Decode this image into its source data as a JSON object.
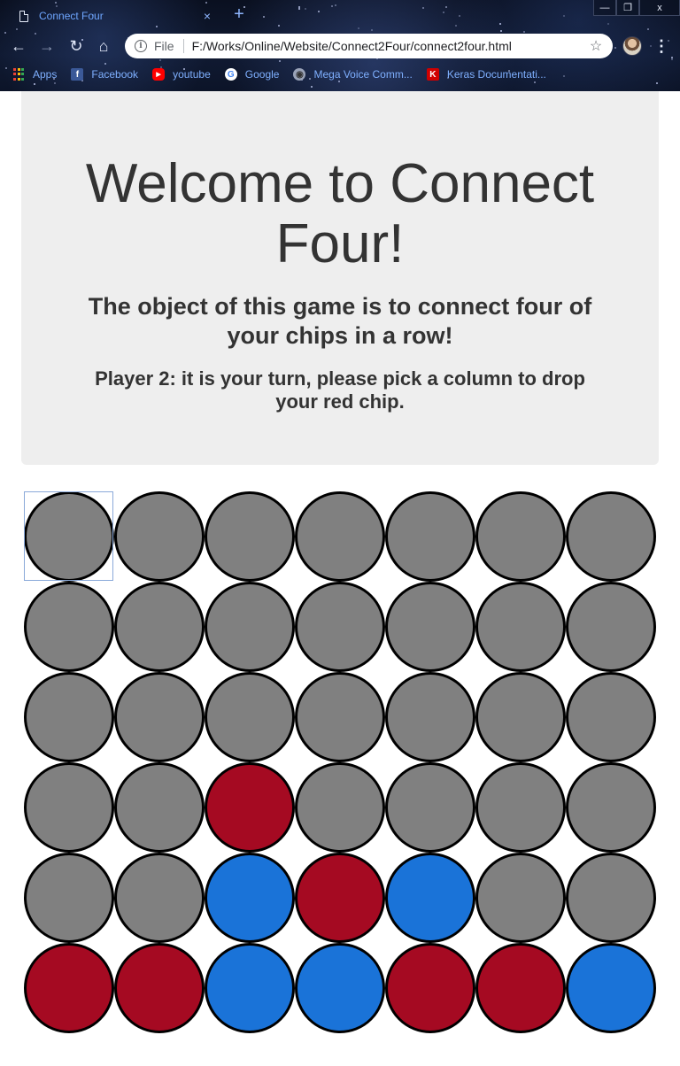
{
  "browser": {
    "tab_title": "Connect Four",
    "tab_close": "×",
    "new_tab": "+",
    "window_controls": {
      "minimize": "—",
      "restore": "❐",
      "close": "x"
    },
    "address": {
      "scheme": "File",
      "url": "F:/Works/Online/Website/Connect2Four/connect2four.html"
    },
    "bookmarks": [
      {
        "label": "Apps",
        "icon": "apps-grid-icon"
      },
      {
        "label": "Facebook",
        "icon": "facebook-icon"
      },
      {
        "label": "youtube",
        "icon": "youtube-icon"
      },
      {
        "label": "Google",
        "icon": "google-icon"
      },
      {
        "label": "Mega Voice Comm...",
        "icon": "mega-voice-icon"
      },
      {
        "label": "Keras Documentati...",
        "icon": "keras-icon"
      }
    ]
  },
  "page": {
    "title": "Welcome to Connect Four!",
    "subtitle": "The object of this game is to connect four of your chips in a row!",
    "turn_message": "Player 2: it is your turn, please pick a column to drop your red chip."
  },
  "game": {
    "rows": 6,
    "columns": 7,
    "colors": {
      "empty": "#808080",
      "red": "#a50a22",
      "blue": "#1a73d8",
      "border": "#000000"
    },
    "board": [
      [
        "empty",
        "empty",
        "empty",
        "empty",
        "empty",
        "empty",
        "empty"
      ],
      [
        "empty",
        "empty",
        "empty",
        "empty",
        "empty",
        "empty",
        "empty"
      ],
      [
        "empty",
        "empty",
        "empty",
        "empty",
        "empty",
        "empty",
        "empty"
      ],
      [
        "empty",
        "empty",
        "red",
        "empty",
        "empty",
        "empty",
        "empty"
      ],
      [
        "empty",
        "empty",
        "blue",
        "red",
        "blue",
        "empty",
        "empty"
      ],
      [
        "red",
        "red",
        "blue",
        "blue",
        "red",
        "red",
        "blue"
      ]
    ]
  }
}
